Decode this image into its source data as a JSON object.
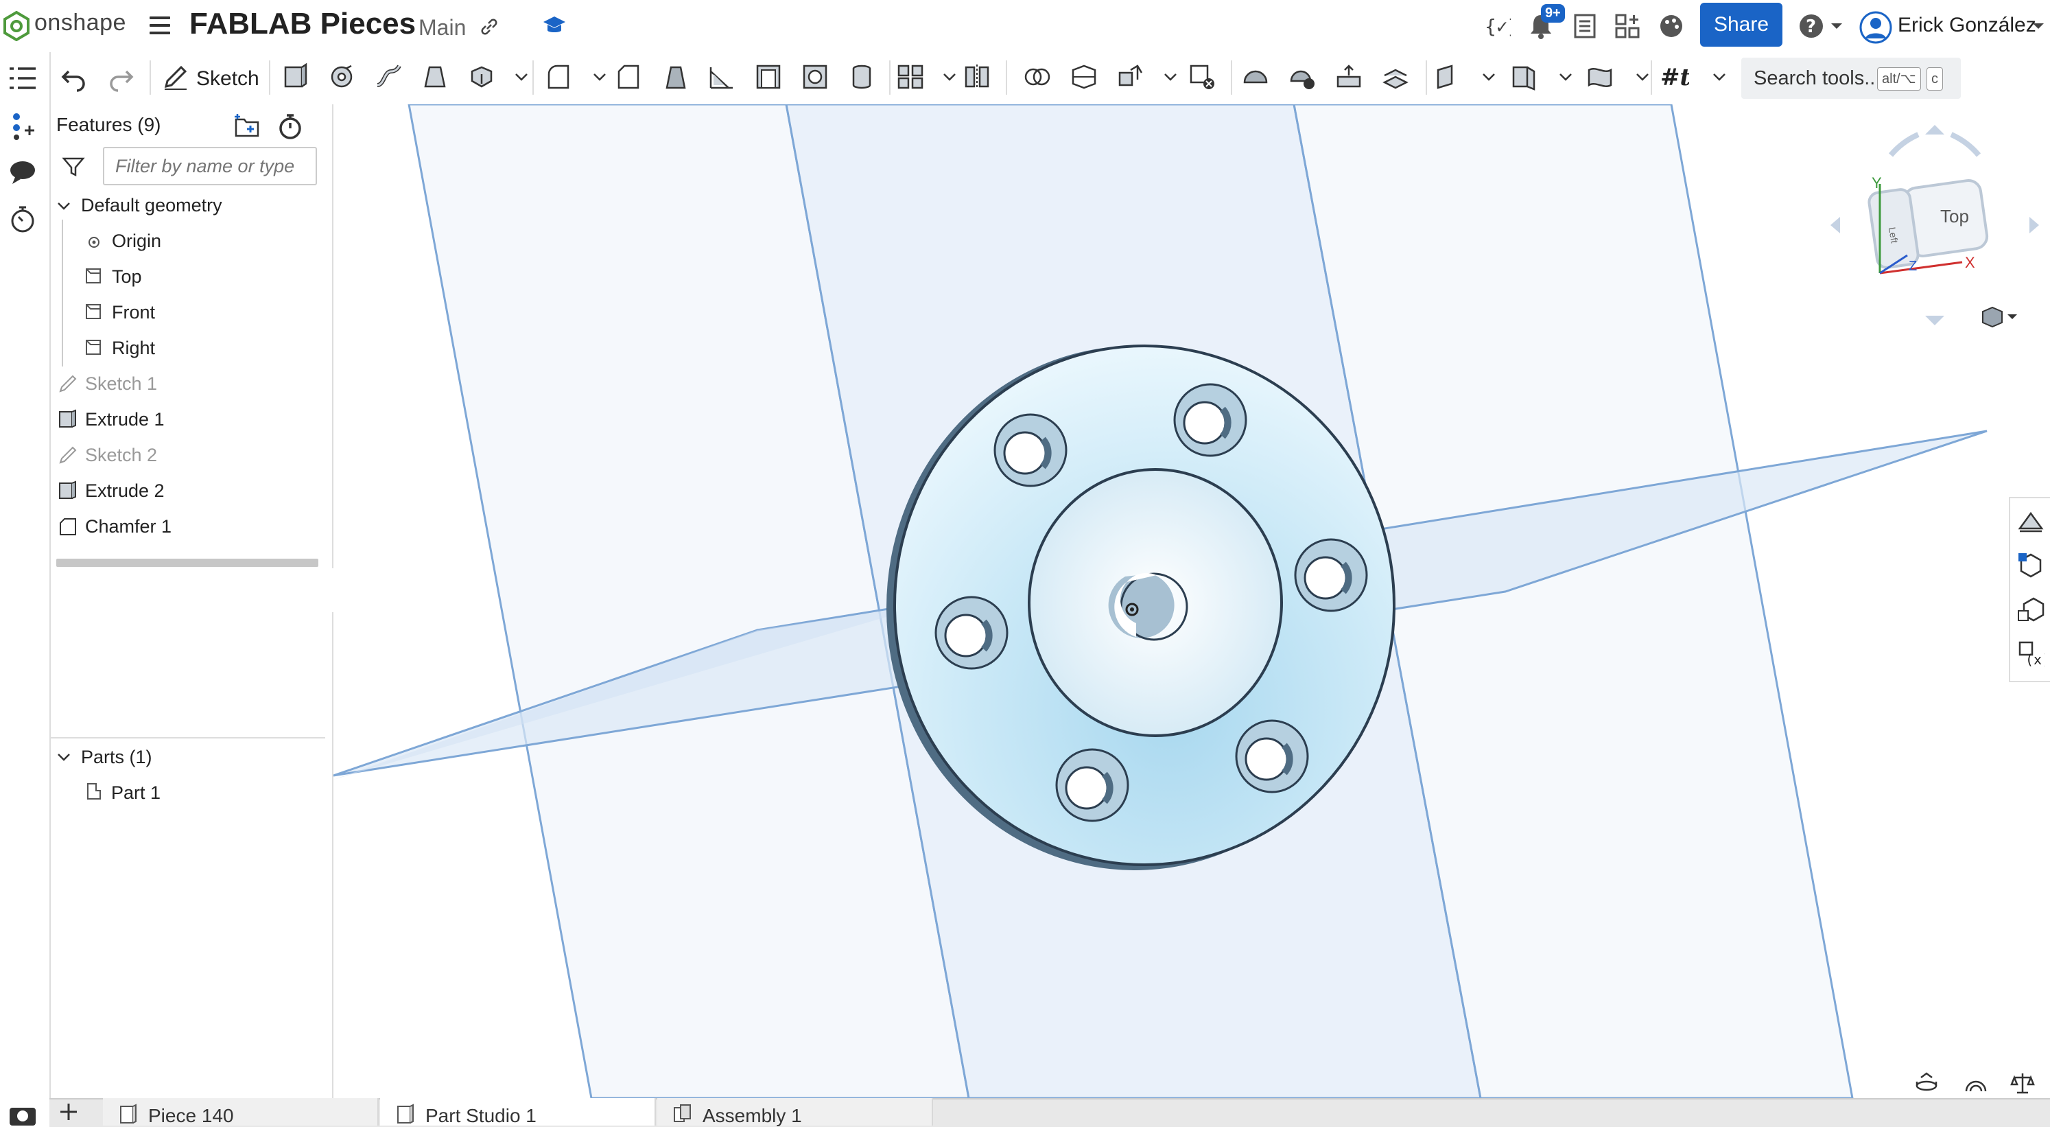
{
  "app": {
    "logo_text": "onshape"
  },
  "document": {
    "title": "FABLAB Pieces",
    "branch": "Main"
  },
  "header": {
    "notifications_badge": "9+",
    "share_label": "Share",
    "user_name": "Erick González"
  },
  "toolbar": {
    "sketch_label": "Sketch",
    "search_label": "Search tools...",
    "shortcut_keys": [
      "alt/⌥",
      "c"
    ]
  },
  "features": {
    "title": "Features (9)",
    "filter_placeholder": "Filter by name or type",
    "default_geometry_label": "Default geometry",
    "default_items": [
      "Origin",
      "Top",
      "Front",
      "Right"
    ],
    "items": [
      "Sketch 1",
      "Extrude 1",
      "Sketch 2",
      "Extrude 2",
      "Chamfer 1"
    ]
  },
  "parts": {
    "title": "Parts (1)",
    "items": [
      "Part 1"
    ]
  },
  "view_cube": {
    "face_top": "Top",
    "face_left": "Left",
    "axis_x": "X",
    "axis_y": "Y",
    "axis_z": "Z"
  },
  "tabs": [
    "Piece 140",
    "Part Studio 1",
    "Assembly 1"
  ],
  "colors": {
    "accent": "#1a64c6",
    "part_fill": "#d4ecf6",
    "plane": "#cfe0f5"
  }
}
